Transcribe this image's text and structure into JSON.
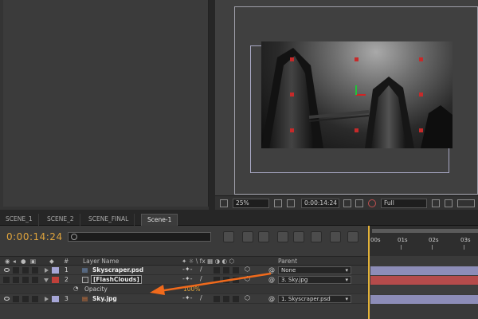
{
  "tabs": [
    {
      "label": "SCENE_1",
      "active": false
    },
    {
      "label": "SCENE_2",
      "active": false
    },
    {
      "label": "SCENE_FINAL",
      "active": false
    },
    {
      "label": "Scene-1",
      "active": true
    }
  ],
  "viewer_bar": {
    "zoom": "25%",
    "timecode": "0:00:14:24",
    "resolution": "Full"
  },
  "timeline": {
    "current_time": "0:00:14:24",
    "search_placeholder": "",
    "ruler_labels": [
      "00s",
      "01s",
      "02s",
      "03s"
    ],
    "columns": {
      "layer_name": "Layer Name",
      "parent": "Parent"
    },
    "layers": [
      {
        "index": "1",
        "name": "Skyscraper.psd",
        "label_color": "#a6a6d6",
        "parent": "None",
        "expanded": false,
        "bar_color": "#8d8db8"
      },
      {
        "index": "2",
        "name": "[FlashClouds]",
        "label_color": "#c0403a",
        "parent": "3. Sky.jpg",
        "expanded": true,
        "bar_color": "#b54b4b"
      },
      {
        "index": "3",
        "name": "Sky.jpg",
        "label_color": "#a6a6d6",
        "parent": "1. Skyscraper.psd",
        "expanded": false,
        "bar_color": "#8d8db8"
      }
    ],
    "opacity_property": {
      "label": "Opacity",
      "value": "100%"
    }
  },
  "colors": {
    "timecode": "#e0a43c",
    "playhead": "#e4b339",
    "annotation_arrow": "#f06a1c"
  }
}
